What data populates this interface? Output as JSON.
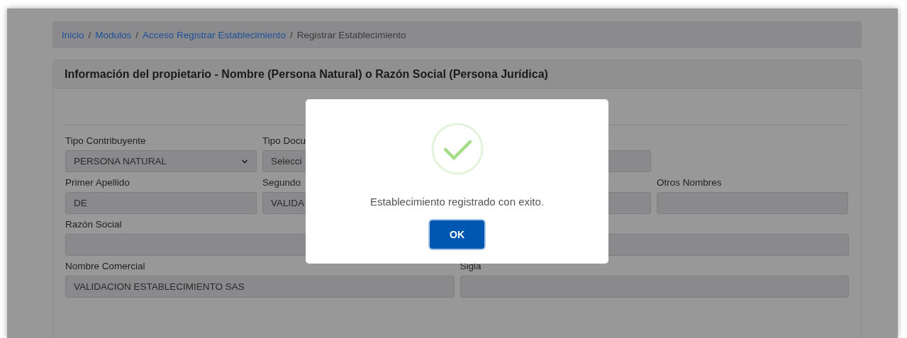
{
  "breadcrumb_separator": "/",
  "breadcrumb": [
    {
      "label": "Inicio",
      "current": false
    },
    {
      "label": "Modulos",
      "current": false
    },
    {
      "label": "Acceso Registrar Establecimiento",
      "current": false
    },
    {
      "label": "Registrar Establecimiento",
      "current": true
    }
  ],
  "card": {
    "title": "Información del propietario - Nombre (Persona Natural) o Razón Social (Persona Jurídica)",
    "rows": [
      [
        {
          "kind": "select",
          "label": "Tipo Contribuyente",
          "value": "PERSONA NATURAL"
        },
        {
          "kind": "text",
          "label": "Tipo Docu",
          "value": "Selecci"
        },
        {
          "kind": "text"
        }
      ],
      [
        {
          "kind": "text",
          "label": "Primer Apellido",
          "value": "DE"
        },
        {
          "kind": "text",
          "label": "Segundo",
          "value": "VALIDA"
        },
        {
          "kind": "text"
        },
        {
          "kind": "text",
          "label": "Otros Nombres"
        }
      ],
      [
        {
          "kind": "text",
          "label": "Razón Social"
        }
      ],
      [
        {
          "kind": "text",
          "label": "Nombre Comercial",
          "value": "VALIDACION ESTABLECIMIENTO SAS"
        },
        {
          "kind": "text",
          "label": "Sigla"
        }
      ]
    ]
  },
  "dialog": {
    "message": "Establecimiento registrado con exito.",
    "button": "OK"
  }
}
